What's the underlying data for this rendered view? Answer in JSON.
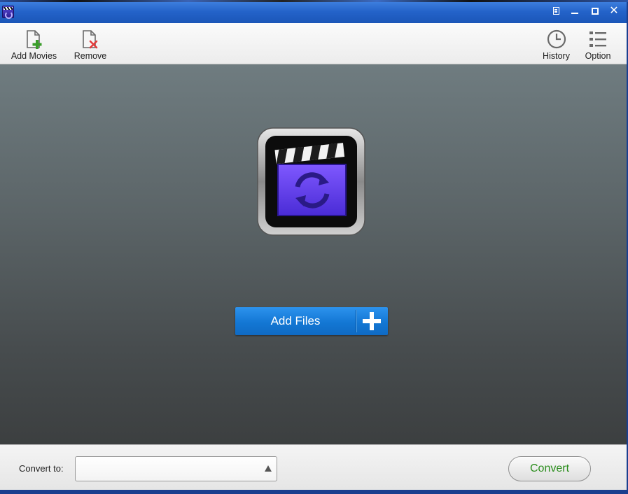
{
  "window": {
    "title": "",
    "controls": [
      "menu-icon",
      "minimize-icon",
      "maximize-icon",
      "close-icon"
    ]
  },
  "toolbar": {
    "add_movies_label": "Add Movies",
    "remove_label": "Remove",
    "history_label": "History",
    "option_label": "Option"
  },
  "main": {
    "add_files_label": "Add Files"
  },
  "bottom": {
    "convert_to_label": "Convert to:",
    "convert_to_value": "",
    "convert_button_label": "Convert"
  },
  "colors": {
    "titlebar": "#2463c9",
    "add_files_button": "#1377d4",
    "convert_text": "#2a8d1c",
    "remove_x": "#e33a3a",
    "add_plus": "#3a9d2a"
  }
}
